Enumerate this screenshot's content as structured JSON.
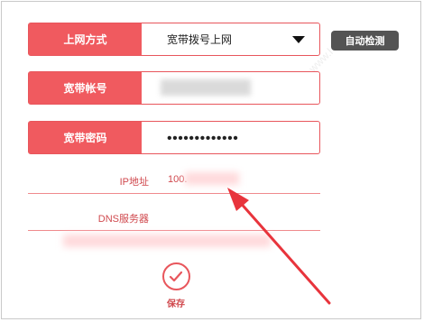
{
  "form": {
    "connection_type": {
      "label": "上网方式",
      "value": "宽带拨号上网"
    },
    "auto_detect_label": "自动检测",
    "account": {
      "label": "宽带帐号",
      "value": ""
    },
    "password": {
      "label": "宽带密码",
      "value": "•••••••••••••"
    },
    "ip": {
      "label": "IP地址",
      "value": "100."
    },
    "dns": {
      "label": "DNS服务器",
      "value": ""
    },
    "save_label": "保存"
  },
  "colors": {
    "accent": "#f05a5f",
    "border": "#e8565c",
    "button_dark": "#545454",
    "arrow": "#e8343c"
  },
  "icons": {
    "dropdown": "chevron-down-icon",
    "save": "check-circle-icon",
    "annotation": "arrow-icon"
  }
}
